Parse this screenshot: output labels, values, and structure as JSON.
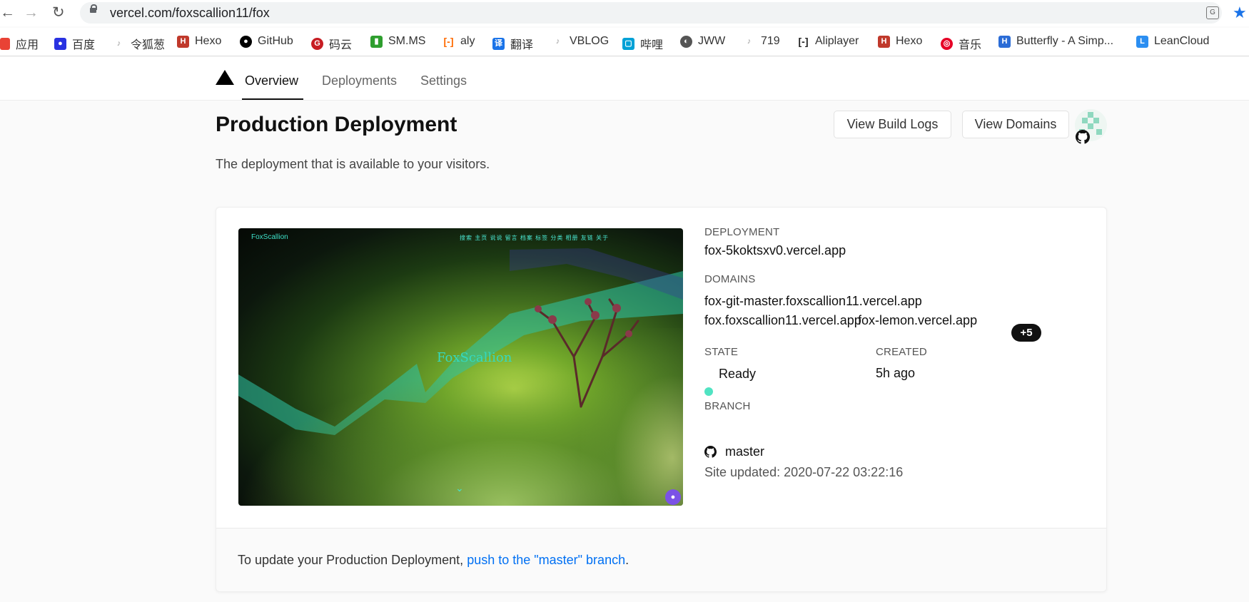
{
  "browser": {
    "url": "vercel.com/foxscallion11/fox",
    "bookmarks": [
      {
        "label": "应用",
        "icon": "apps-grid-icon",
        "color": "#e94235"
      },
      {
        "label": "百度",
        "icon": "baidu-paw-icon",
        "color": "#2932e1"
      },
      {
        "label": "令狐葱",
        "icon": "music-note-icon",
        "color": "#999999"
      },
      {
        "label": "Hexo",
        "icon": "hexo-icon",
        "color": "#c0392b"
      },
      {
        "label": "GitHub",
        "icon": "github-icon",
        "color": "#000000"
      },
      {
        "label": "码云",
        "icon": "gitee-icon",
        "color": "#c71d23"
      },
      {
        "label": "SM.MS",
        "icon": "bar-chart-icon",
        "color": "#2e9e2e"
      },
      {
        "label": "aly",
        "icon": "aliyun-icon",
        "color": "#ff6a00"
      },
      {
        "label": "翻译",
        "icon": "translate-icon",
        "color": "#1a73e8"
      },
      {
        "label": "VBLOG",
        "icon": "music-note-icon",
        "color": "#999999"
      },
      {
        "label": "哔哩",
        "icon": "bilibili-tv-icon",
        "color": "#00a1d6"
      },
      {
        "label": "JWW",
        "icon": "globe-icon",
        "color": "#555555"
      },
      {
        "label": "719",
        "icon": "music-note-icon",
        "color": "#999999"
      },
      {
        "label": "Aliplayer",
        "icon": "aliyun-icon",
        "color": "#222222"
      },
      {
        "label": "Hexo",
        "icon": "hexo-icon",
        "color": "#c0392b"
      },
      {
        "label": "音乐",
        "icon": "netease-music-icon",
        "color": "#e60026"
      },
      {
        "label": "Butterfly - A Simp...",
        "icon": "butterfly-h-icon",
        "color": "#2b6cd6"
      },
      {
        "label": "LeanCloud",
        "icon": "leancloud-icon",
        "color": "#2b8ef1"
      }
    ]
  },
  "header": {
    "tabs": [
      "Overview",
      "Deployments",
      "Settings"
    ],
    "active_tab": "Overview"
  },
  "page": {
    "title": "Production Deployment",
    "subtitle": "The deployment that is available to your visitors.",
    "view_build_logs": "View Build Logs",
    "view_domains": "View Domains"
  },
  "deployment": {
    "preview": {
      "logo": "FoxScallion",
      "center_text": "FoxScallion",
      "menu": "搜索 主页 说说 留言 档案 标签 分类 相册 友链 关于"
    },
    "deployment_label": "DEPLOYMENT",
    "deployment_url": "fox-5koktsxv0.vercel.app",
    "domains_label": "DOMAINS",
    "domains": [
      "fox-git-master.foxscallion11.vercel.app",
      "fox.foxscallion11.vercel.app",
      "fox-lemon.vercel.app"
    ],
    "more_domains": "+5",
    "state_label": "STATE",
    "state": "Ready",
    "state_color": "#50e3c2",
    "created_label": "CREATED",
    "created": "5h ago",
    "branch_label": "BRANCH",
    "branch": "master",
    "site_updated": "Site updated: 2020-07-22 03:22:16"
  },
  "footer": {
    "text_before": "To update your Production Deployment, ",
    "link": "push to the \"master\" branch",
    "text_after": "."
  }
}
